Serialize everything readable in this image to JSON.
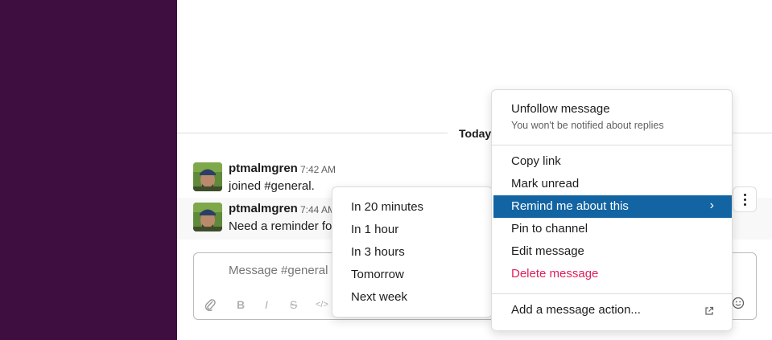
{
  "channel": {
    "day_divider": "Today"
  },
  "messages": [
    {
      "author": "ptmalmgren",
      "time": "7:42 AM",
      "text": "joined #general."
    },
    {
      "author": "ptmalmgren",
      "time": "7:44 AM",
      "text": "Need a reminder for"
    }
  ],
  "composer": {
    "placeholder": "Message #general"
  },
  "context_menu": {
    "unfollow_label": "Unfollow message",
    "unfollow_sub": "You won't be notified about replies",
    "copy_link": "Copy link",
    "mark_unread": "Mark unread",
    "remind": "Remind me about this",
    "pin": "Pin to channel",
    "edit": "Edit message",
    "delete": "Delete message",
    "add_action": "Add a message action...",
    "active_color": "#1264a3",
    "danger_color": "#e01e5a"
  },
  "remind_submenu": [
    {
      "label": "In 20 minutes"
    },
    {
      "label": "In 1 hour"
    },
    {
      "label": "In 3 hours"
    },
    {
      "label": "Tomorrow"
    },
    {
      "label": "Next week"
    }
  ],
  "colors": {
    "sidebar": "#3f0e40"
  }
}
